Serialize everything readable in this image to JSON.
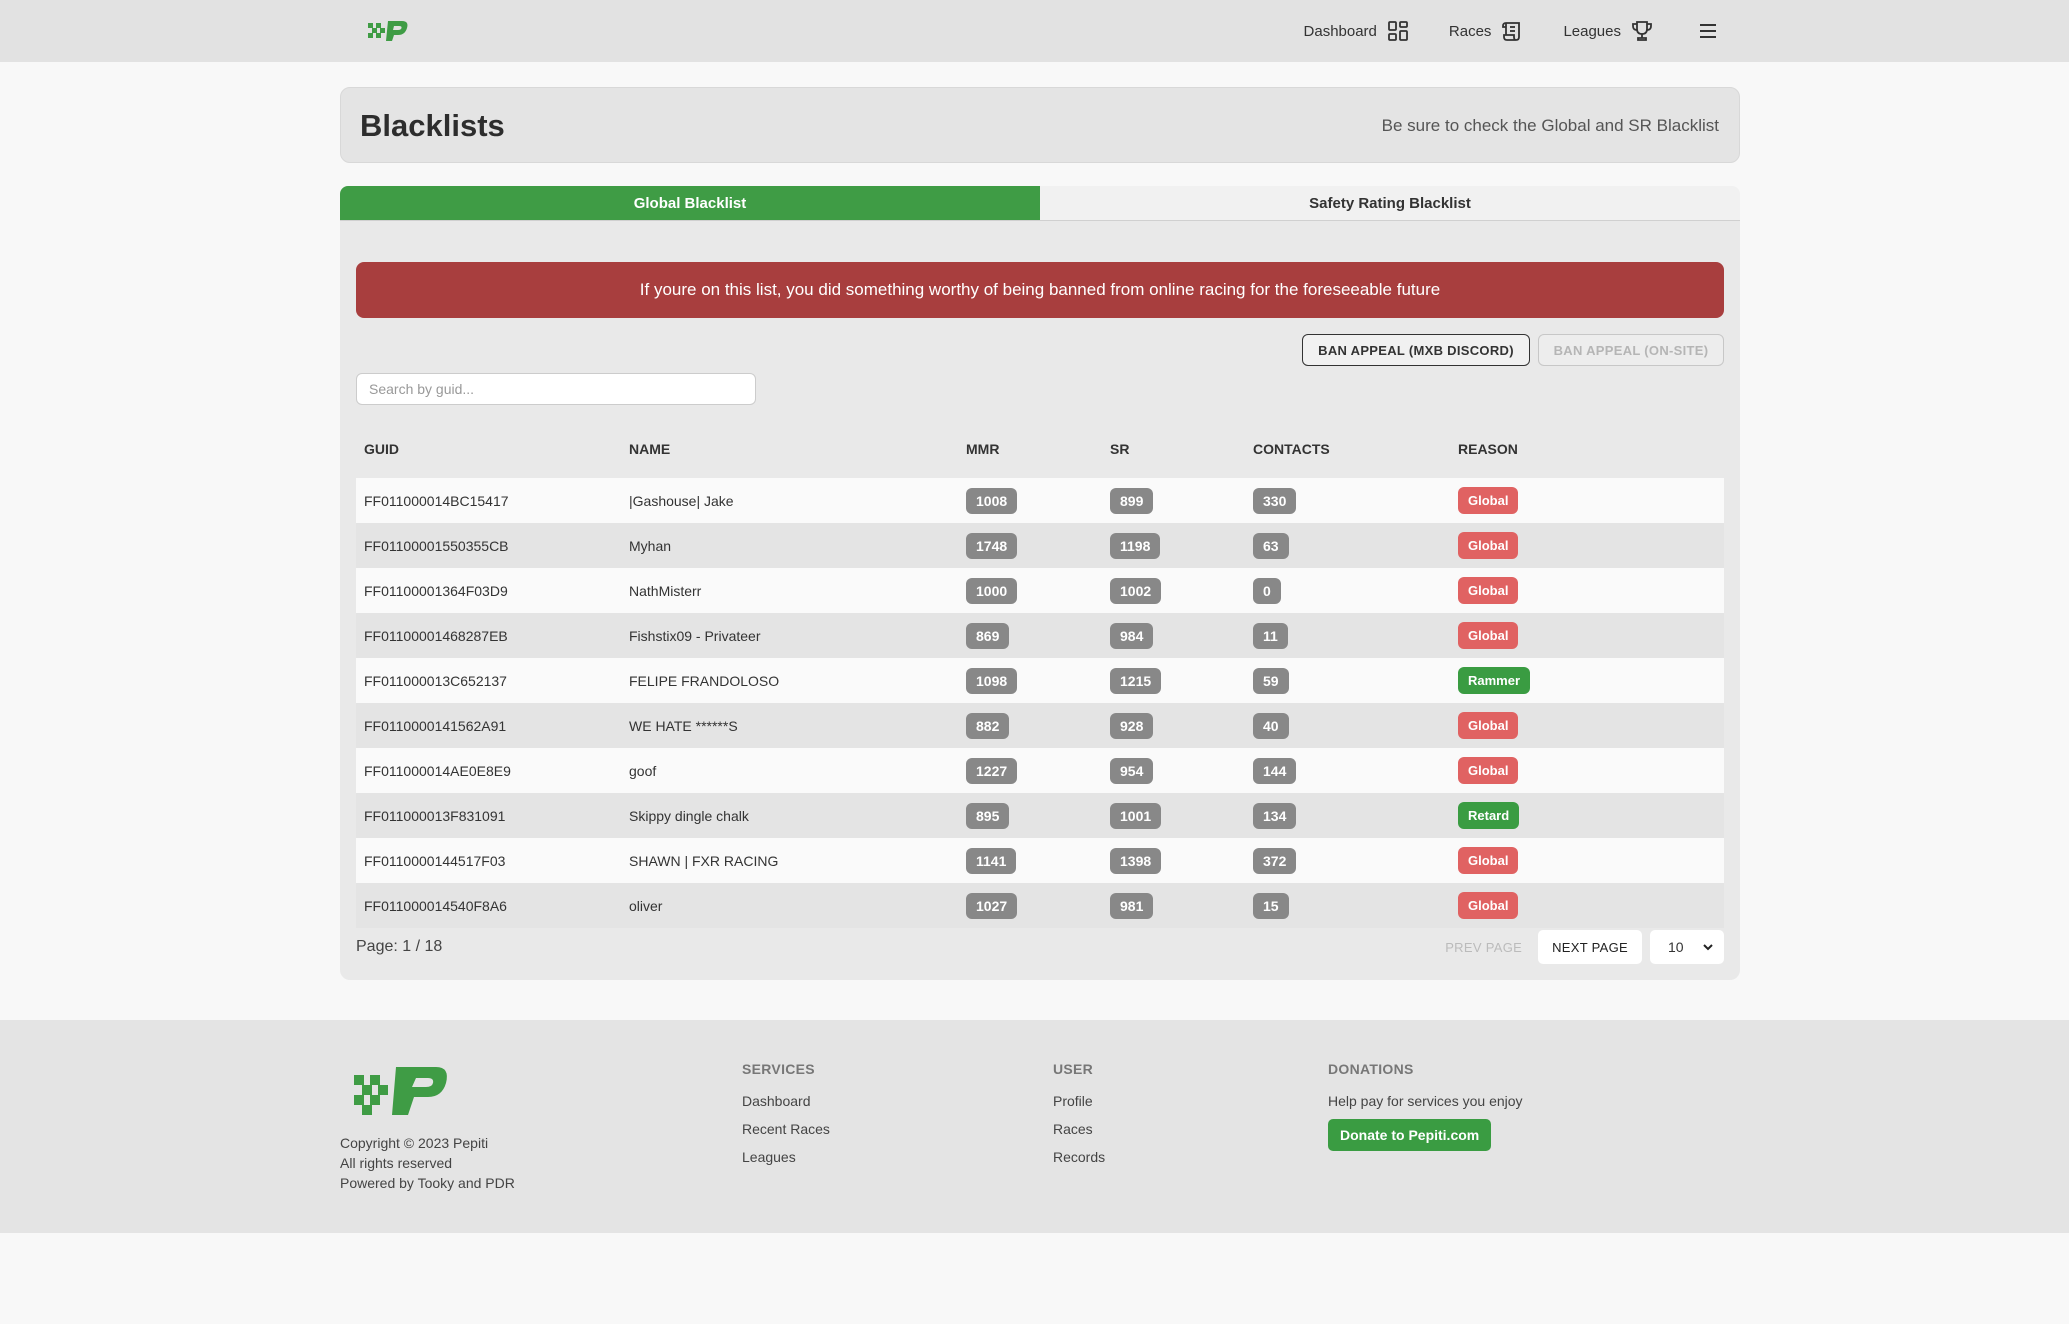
{
  "nav": {
    "items": [
      {
        "label": "Dashboard",
        "icon": "grid-icon"
      },
      {
        "label": "Races",
        "icon": "scroll-icon"
      },
      {
        "label": "Leagues",
        "icon": "trophy-icon"
      }
    ]
  },
  "header": {
    "title": "Blacklists",
    "hint": "Be sure to check the Global and SR Blacklist"
  },
  "tabs": {
    "global": "Global Blacklist",
    "safety": "Safety Rating Blacklist"
  },
  "alert": "If youre on this list, you did something worthy of being banned from online racing for the foreseeable future",
  "buttons": {
    "appeal_discord": "BAN APPEAL (MXB DISCORD)",
    "appeal_onsite": "BAN APPEAL (ON-SITE)"
  },
  "search": {
    "placeholder": "Search by guid..."
  },
  "table": {
    "headers": {
      "guid": "GUID",
      "name": "NAME",
      "mmr": "MMR",
      "sr": "SR",
      "contacts": "CONTACTS",
      "reason": "REASON"
    },
    "rows": [
      {
        "guid": "FF011000014BC15417",
        "name": "|Gashouse| Jake",
        "mmr": "1008",
        "sr": "899",
        "contacts": "330",
        "reason": "Global"
      },
      {
        "guid": "FF01100001550355CB",
        "name": "Myhan",
        "mmr": "1748",
        "sr": "1198",
        "contacts": "63",
        "reason": "Global"
      },
      {
        "guid": "FF01100001364F03D9",
        "name": "NathMisterr",
        "mmr": "1000",
        "sr": "1002",
        "contacts": "0",
        "reason": "Global"
      },
      {
        "guid": "FF01100001468287EB",
        "name": "Fishstix09 - Privateer",
        "mmr": "869",
        "sr": "984",
        "contacts": "11",
        "reason": "Global"
      },
      {
        "guid": "FF011000013C652137",
        "name": "FELIPE FRANDOLOSO",
        "mmr": "1098",
        "sr": "1215",
        "contacts": "59",
        "reason": "Rammer"
      },
      {
        "guid": "FF0110000141562A91",
        "name": "WE HATE ******S",
        "mmr": "882",
        "sr": "928",
        "contacts": "40",
        "reason": "Global"
      },
      {
        "guid": "FF011000014AE0E8E9",
        "name": "goof",
        "mmr": "1227",
        "sr": "954",
        "contacts": "144",
        "reason": "Global"
      },
      {
        "guid": "FF011000013F831091",
        "name": "Skippy dingle chalk",
        "mmr": "895",
        "sr": "1001",
        "contacts": "134",
        "reason": "Retard"
      },
      {
        "guid": "FF0110000144517F03",
        "name": "SHAWN | FXR RACING",
        "mmr": "1141",
        "sr": "1398",
        "contacts": "372",
        "reason": "Global"
      },
      {
        "guid": "FF011000014540F8A6",
        "name": "oliver",
        "mmr": "1027",
        "sr": "981",
        "contacts": "15",
        "reason": "Global"
      }
    ]
  },
  "pagination": {
    "page_info": "Page: 1 / 18",
    "prev": "PREV PAGE",
    "next": "NEXT PAGE",
    "page_size": "10"
  },
  "footer": {
    "copyright": "Copyright © 2023 Pepiti",
    "rights": "All rights reserved",
    "powered": "Powered by Tooky and PDR",
    "services": {
      "title": "SERVICES",
      "links": [
        "Dashboard",
        "Recent Races",
        "Leagues"
      ]
    },
    "user": {
      "title": "USER",
      "links": [
        "Profile",
        "Races",
        "Records"
      ]
    },
    "donations": {
      "title": "DONATIONS",
      "text": "Help pay for services you enjoy",
      "button": "Donate to Pepiti.com"
    }
  },
  "colors": {
    "brand_green": "#3f9c45",
    "alert_red": "#a83e3e",
    "tag_red": "#e06262"
  }
}
